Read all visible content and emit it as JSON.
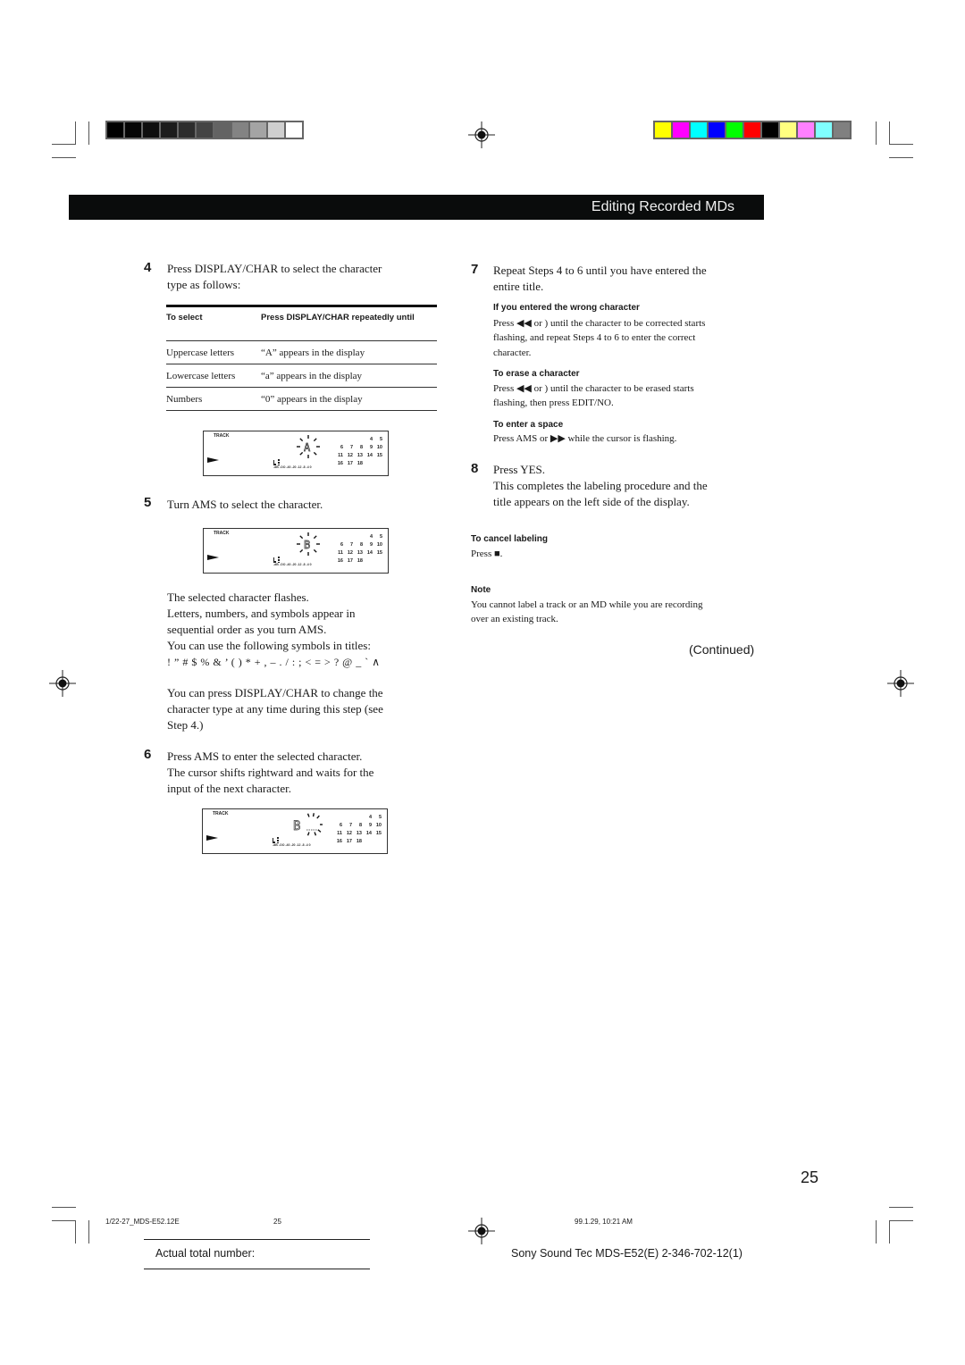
{
  "print_marks": {
    "grayscale_bar": [
      "#000000",
      "#050505",
      "#0e0e0e",
      "#1c1c1c",
      "#2d2d2d",
      "#444444",
      "#636363",
      "#838383",
      "#a4a4a4",
      "#cfcfcf",
      "#ffffff"
    ],
    "color_bar": [
      "#ffff00",
      "#ff00ff",
      "#00ffff",
      "#0000ff",
      "#00ff00",
      "#ff0000",
      "#000000",
      "#ffff80",
      "#ff80ff",
      "#80ffff",
      "#808080"
    ]
  },
  "header": {
    "section_title": "Editing Recorded MDs"
  },
  "left_column": {
    "step4": {
      "number": "4",
      "text_line1": "Press DISPLAY/CHAR to select the character",
      "text_line2": "type as follows:",
      "table": {
        "headers": [
          "To select",
          "Press DISPLAY/CHAR repeatedly until"
        ],
        "rows": [
          [
            "Uppercase letters",
            "“A” appears in the display"
          ],
          [
            "Lowercase letters",
            "“a” appears in the display"
          ],
          [
            "Numbers",
            "“0” appears in the display"
          ]
        ]
      }
    },
    "lcd": {
      "track_label": "TRACK",
      "numbers_rows": [
        [
          "4",
          "5"
        ],
        [
          "6",
          "7",
          "8",
          "9",
          "10"
        ],
        [
          "11",
          "12",
          "13",
          "14",
          "15"
        ],
        [
          "16",
          "17",
          "18"
        ]
      ],
      "meter_scale": "-dB -OO -40   -20 -12  -8  -4  0",
      "display1_char": "A",
      "display2_char": "B",
      "display3_char": "B"
    },
    "step5": {
      "number": "5",
      "text": "Turn AMS to select the character.",
      "para1": [
        "The selected character flashes.",
        "Letters, numbers, and symbols appear in",
        "sequential order as you turn AMS.",
        "You can use the following symbols in titles:"
      ],
      "symbols": "!  ” # $ % & ’ ( ) * + , – . / : ; < = > ? @ _ `  ∧",
      "para2": [
        "You can press DISPLAY/CHAR to change the",
        "character type at any time during this step (see",
        "Step 4.)"
      ]
    },
    "step6": {
      "number": "6",
      "lines": [
        "Press AMS to enter the selected character.",
        "The cursor shifts rightward and waits for the",
        "input of the next character."
      ]
    }
  },
  "right_column": {
    "step7": {
      "number": "7",
      "lines": [
        "Repeat Steps 4 to 6 until you have entered the",
        "entire title."
      ],
      "wrong_char": {
        "heading": "If you entered the wrong character",
        "lines": [
          "Press ◀◀ or )      until the character to be corrected starts",
          "flashing, and repeat Steps 4 to 6 to enter the correct",
          "character."
        ]
      },
      "erase_char": {
        "heading": "To erase a character",
        "lines": [
          "Press ◀◀ or )      until the character to be erased starts",
          "flashing, then press EDIT/NO."
        ]
      },
      "enter_space": {
        "heading": "To enter a space",
        "lines": [
          "Press AMS or ▶▶ while the cursor is flashing."
        ]
      }
    },
    "step8": {
      "number": "8",
      "lines": [
        "Press YES.",
        "This completes the labeling procedure and the",
        "title appears on the left side of the display."
      ]
    },
    "cancel": {
      "heading": "To cancel labeling",
      "text": "Press ■."
    },
    "note": {
      "heading": "Note",
      "lines": [
        "You cannot label a track or an MD while you are recording",
        "over an existing track."
      ]
    },
    "continued": "(Continued)"
  },
  "page_number": "25",
  "footer": {
    "file_name": "1/22-27_MDS-E52.12E",
    "file_page": "25",
    "timestamp": "99.1.29, 10:21 AM",
    "actual_total_label": "Actual total number:",
    "product_code": "Sony Sound Tec MDS-E52(E) 2-346-702-12(1)"
  }
}
